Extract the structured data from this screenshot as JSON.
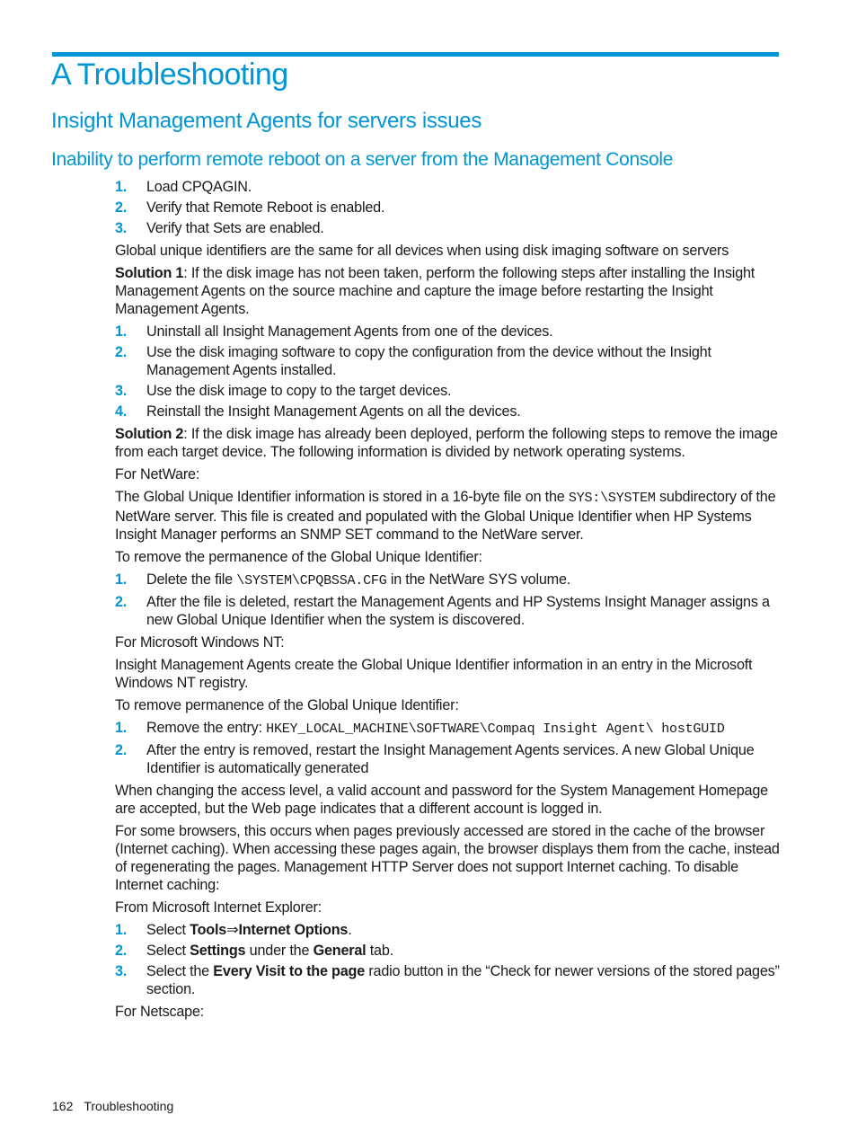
{
  "headings": {
    "chapter": "A Troubleshooting",
    "section": "Insight Management Agents for servers issues",
    "subsection": "Inability to perform remote reboot on a server from the Management Console"
  },
  "reboot_steps": [
    "Load CPQAGIN.",
    "Verify that Remote Reboot is enabled.",
    "Verify that Sets are enabled."
  ],
  "guid_title": "Global unique identifiers are the same for all devices when using disk imaging software on servers",
  "solution1": {
    "label": "Solution 1",
    "text": ": If the disk image has not been taken, perform the following steps after installing the Insight Management Agents on the source machine and capture the image before restarting the Insight Management Agents."
  },
  "solution1_steps": [
    "Uninstall all Insight Management Agents from one of the devices.",
    "Use the disk imaging software to copy the configuration from the device without the Insight Management Agents installed.",
    "Use the disk image to copy to the target devices.",
    "Reinstall the Insight Management Agents on all the devices."
  ],
  "solution2": {
    "label": "Solution 2",
    "text": ": If the disk image has already been deployed, perform the following steps to remove the image from each target device. The following information is divided by network operating systems."
  },
  "netware": {
    "intro": "For NetWare:",
    "para_a": "The Global Unique Identifier information is stored in a 16-byte file on the ",
    "para_code": "SYS:\\SYSTEM",
    "para_b": " subdirectory of the NetWare server. This file is created and populated with the Global Unique Identifier when HP Systems Insight Manager performs an SNMP SET command to the NetWare server.",
    "remove_intro": "To remove the permanence of the Global Unique Identifier:",
    "step1_a": "Delete the file ",
    "step1_code": "\\SYSTEM\\CPQBSSA.CFG",
    "step1_b": " in the NetWare SYS volume.",
    "step2": "After the file is deleted, restart the Management Agents and HP Systems Insight Manager assigns a new Global Unique Identifier when the system is discovered."
  },
  "windows_nt": {
    "intro": "For Microsoft Windows NT:",
    "para": "Insight Management Agents create the Global Unique Identifier information in an entry in the Microsoft Windows NT registry.",
    "remove_intro": "To remove permanence of the Global Unique Identifier:",
    "step1_a": "Remove the entry: ",
    "step1_code": "HKEY_LOCAL_MACHINE\\SOFTWARE\\Compaq Insight Agent\\ hostGUID",
    "step2": "After the entry is removed, restart the Insight Management Agents services. A new Global Unique Identifier is automatically generated"
  },
  "access": {
    "para1": "When changing the access level, a valid account and password for the System Management Homepage are accepted, but the Web page indicates that a different account is logged in.",
    "para2": "For some browsers, this occurs when pages previously accessed are stored in the cache of the browser (Internet caching). When accessing these pages again, the browser displays them from the cache, instead of regenerating the pages. Management HTTP Server does not support Internet caching. To disable Internet caching:",
    "ie_intro": "From Microsoft Internet Explorer:",
    "ie_step1": {
      "a": "Select ",
      "b1": "Tools",
      "arrow": "⇒",
      "b2": "Internet Options",
      "c": "."
    },
    "ie_step2": {
      "a": "Select ",
      "b1": "Settings",
      "c": " under the ",
      "b2": "General",
      "d": " tab."
    },
    "ie_step3": {
      "a": "Select the ",
      "b1": "Every Visit to the page",
      "c": " radio button in the “Check for newer versions of the stored pages” section."
    },
    "netscape_intro": "For Netscape:"
  },
  "footer": {
    "page_number": "162",
    "section": "Troubleshooting"
  }
}
